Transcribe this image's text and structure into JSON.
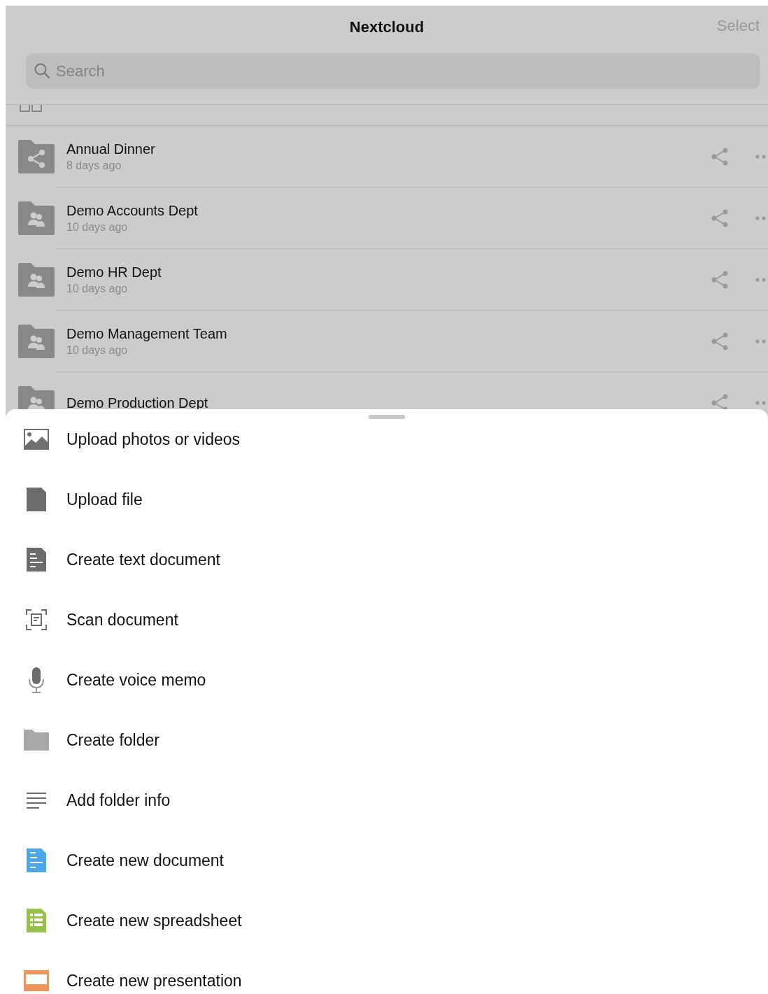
{
  "header": {
    "title": "Nextcloud",
    "action": "Select"
  },
  "search": {
    "placeholder": "Search"
  },
  "files": [
    {
      "name": "Annual Dinner",
      "modified": "8 days ago",
      "kind": "shared"
    },
    {
      "name": "Demo Accounts Dept",
      "modified": "10 days ago",
      "kind": "group"
    },
    {
      "name": "Demo HR Dept",
      "modified": "10 days ago",
      "kind": "group"
    },
    {
      "name": "Demo Management Team",
      "modified": "10 days ago",
      "kind": "group"
    },
    {
      "name": "Demo Production Dept",
      "kind": "group"
    }
  ],
  "menu": [
    {
      "label": "Upload photos or videos",
      "kind": "image"
    },
    {
      "label": "Upload file",
      "kind": "file"
    },
    {
      "label": "Create text document",
      "kind": "text"
    },
    {
      "label": "Scan document",
      "kind": "scan"
    },
    {
      "label": "Create voice memo",
      "kind": "mic"
    },
    {
      "label": "Create folder",
      "kind": "folder"
    },
    {
      "label": "Add folder info",
      "kind": "lines"
    },
    {
      "label": "Create new document",
      "kind": "document"
    },
    {
      "label": "Create new spreadsheet",
      "kind": "spreadsheet"
    },
    {
      "label": "Create new presentation",
      "kind": "presentation"
    }
  ]
}
